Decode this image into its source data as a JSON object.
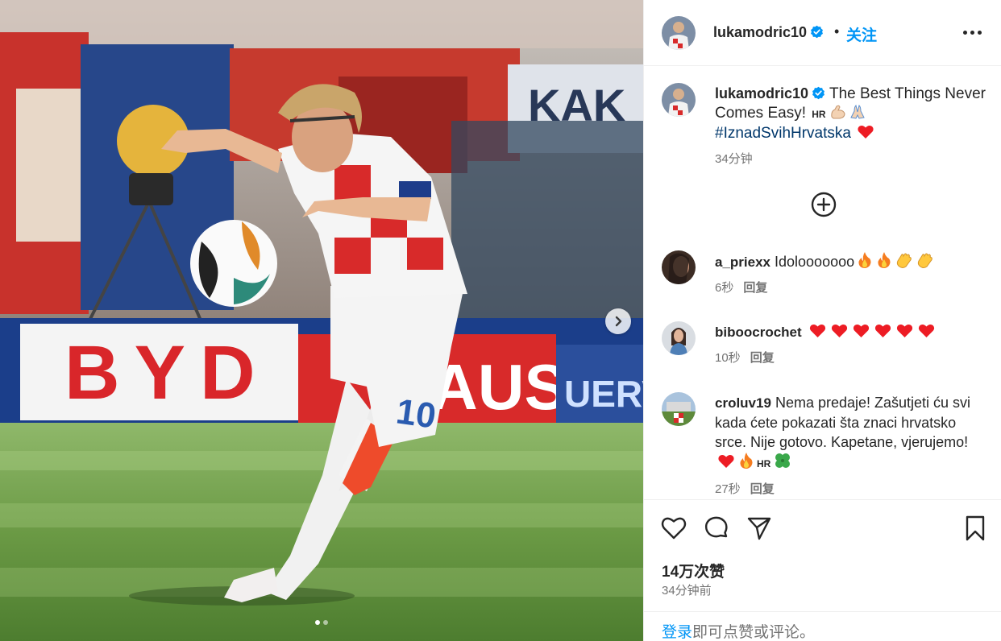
{
  "post": {
    "username": "lukamodric10",
    "separator": "•",
    "follow_label": "关注",
    "caption": {
      "text": "The Best Things Never Comes Easy!",
      "flag": "HR",
      "hashtag": "#IznadSvihHrvatska",
      "time": "34分钟"
    },
    "likes": "14万次赞",
    "posted_time": "34分钟前",
    "login_link": "登录",
    "login_prompt": "即可点赞或评论。"
  },
  "comments": [
    {
      "username": "a_priexx",
      "text": "Idolooooooo",
      "emojis": [
        "fire",
        "fire",
        "clap",
        "clap"
      ],
      "time": "6秒",
      "reply": "回复"
    },
    {
      "username": "biboocrochet",
      "text": "",
      "emojis": [
        "heart",
        "heart",
        "heart",
        "heart",
        "heart",
        "heart"
      ],
      "time": "10秒",
      "reply": "回复"
    },
    {
      "username": "croluv19",
      "text": "Nema predaje! Zašutjeti ću svi kada ćete pokazati šta znaci hrvatsko srce. Nije gotovo. Kapetane, vjerujemo!",
      "emojis": [
        "heart",
        "fire",
        "hr-flag",
        "clover"
      ],
      "flag": "HR",
      "time": "27秒",
      "reply": "回复"
    }
  ],
  "media": {
    "billboard_text_1": "BYD",
    "billboard_text_2": "AUSS",
    "billboard_text_3": "UERV",
    "banner_text": "KAK",
    "jersey_number": "10",
    "carousel_dots": 2,
    "active_dot": 1
  },
  "colors": {
    "accent": "#0095f6",
    "hashtag": "#00376b",
    "muted": "#737373",
    "heart": "#ed1c24"
  },
  "icons": {
    "verified": "verified-badge-icon",
    "more": "more-options-icon",
    "load_more": "plus-circle-icon",
    "like": "heart-outline-icon",
    "comment": "comment-bubble-icon",
    "share": "paper-plane-icon",
    "save": "bookmark-icon",
    "next": "chevron-right-icon"
  }
}
